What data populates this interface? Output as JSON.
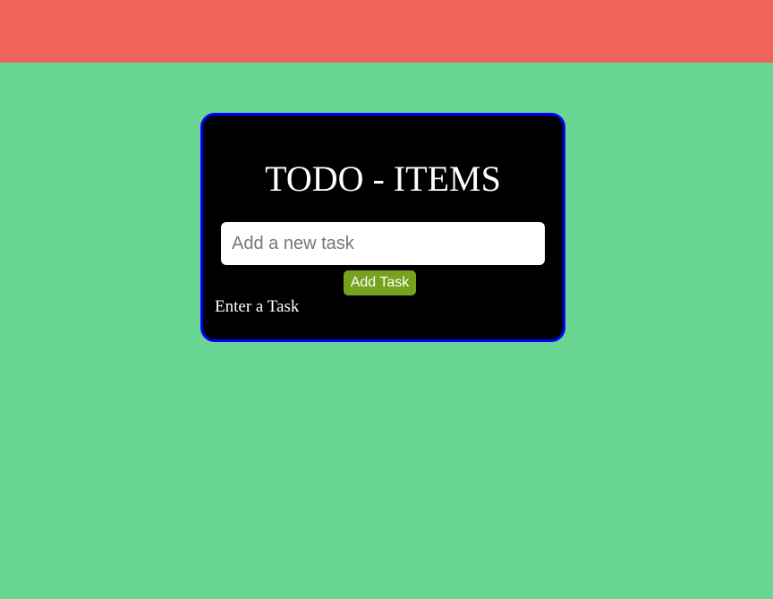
{
  "header": {
    "color": "#f0645c"
  },
  "page": {
    "background": "#69d592"
  },
  "todo_card": {
    "title": "TODO - ITEMS",
    "input": {
      "placeholder": "Add a new task",
      "value": ""
    },
    "add_button_label": "Add Task",
    "status_message": "Enter a Task",
    "colors": {
      "card_background": "#000000",
      "card_border": "#0000ff",
      "button_background": "#76a21e"
    }
  }
}
